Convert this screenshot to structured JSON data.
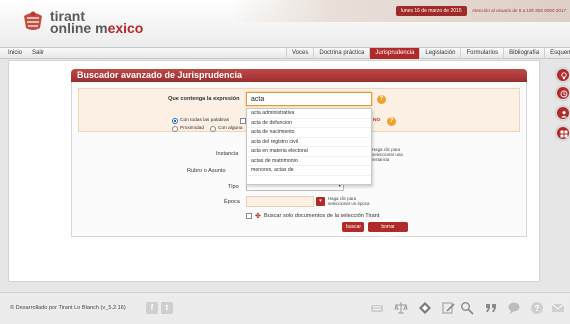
{
  "header": {
    "logo_line1": "tirant",
    "logo_line2_a": "online m",
    "logo_line2_b": "exico",
    "date": "lunes 16 de marzo de 2015",
    "contact": "Atención al usuario de 8 a 18h 800 6000 2017"
  },
  "nav": {
    "left": [
      "Inicio",
      "Salir"
    ],
    "tabs": [
      {
        "label": "Voces",
        "active": false
      },
      {
        "label": "Doctrina práctica",
        "active": false
      },
      {
        "label": "Jurisprudencia",
        "active": true
      },
      {
        "label": "Legislación",
        "active": false
      },
      {
        "label": "Formularios",
        "active": false
      },
      {
        "label": "Bibliografía",
        "active": false
      },
      {
        "label": "Esquemas",
        "active": false
      }
    ]
  },
  "panel": {
    "title": "Buscador avanzado de Jurisprudencia",
    "query_label": "Que contenga la expresión",
    "query_value": "acta",
    "options": {
      "all_words": "Con todas las palabras",
      "proximity": "Proximidad",
      "some": "Con alguna"
    },
    "instancia_label": "Instancia",
    "instancia_hint": "Haga clic para seleccionar una instancia",
    "rubro_label": "Rubro o Asunto",
    "tipo_label": "Tipo",
    "epoca_label": "Época",
    "epoca_hint": "Haga clic para seleccionar un época",
    "tirant_check": "Buscar solo documentos de la selección Tirant",
    "buscar": "buscar",
    "borrar": "borrar campos"
  },
  "autocomplete": [
    "acta administrativa",
    "acta de defuncion",
    "acta de nacimiento",
    "acta del registro civil",
    "acta en materia electoral",
    "actas de matrimonio",
    "menores, actas de"
  ],
  "footer": {
    "credit": "© Desarrollado por Tirant Lo Blanch (v_5.2.16)"
  },
  "colors": {
    "brand_red": "#b02a2a",
    "accent_orange": "#f0a030"
  }
}
